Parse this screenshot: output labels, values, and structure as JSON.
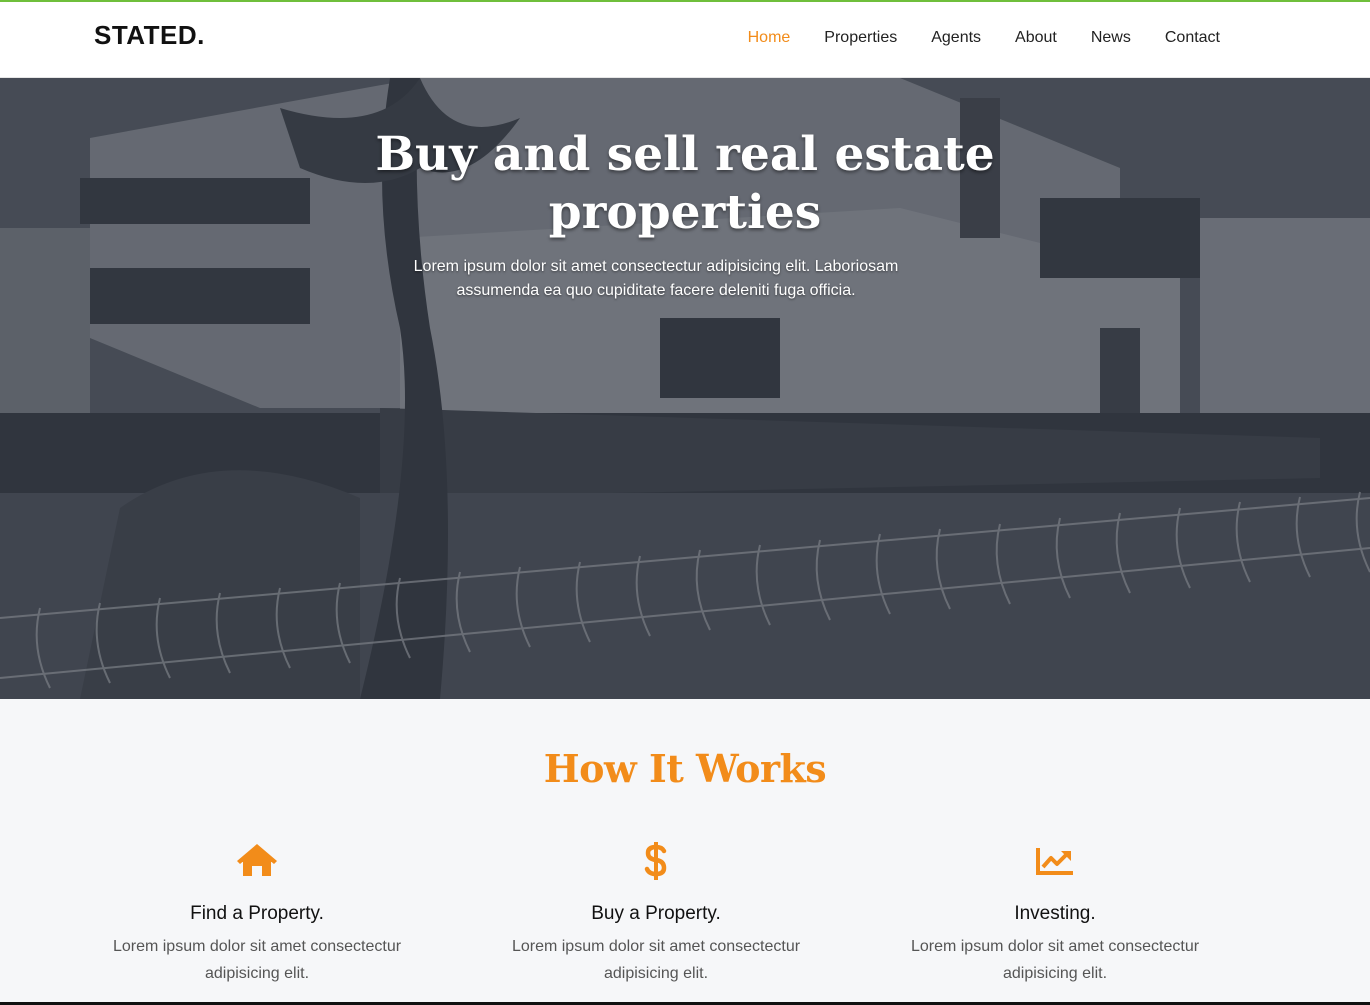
{
  "brand": {
    "logo": "STATED.",
    "accent_color": "#f28c1a",
    "top_accent_color": "#6fbf3b"
  },
  "nav": {
    "items": [
      {
        "label": "Home",
        "active": true
      },
      {
        "label": "Properties",
        "active": false
      },
      {
        "label": "Agents",
        "active": false
      },
      {
        "label": "About",
        "active": false
      },
      {
        "label": "News",
        "active": false
      },
      {
        "label": "Contact",
        "active": false
      }
    ]
  },
  "hero": {
    "title_line1": "Buy and sell real estate",
    "title_line2": "properties",
    "subtitle": "Lorem ipsum dolor sit amet consectectur adipisicing elit. Laboriosam assumenda ea quo cupiditate facere deleniti fuga officia."
  },
  "how_it_works": {
    "title": "How It Works",
    "features": [
      {
        "icon": "home-icon",
        "title": "Find a Property.",
        "text": "Lorem ipsum dolor sit amet consectectur adipisicing elit."
      },
      {
        "icon": "dollar-icon",
        "title": "Buy a Property.",
        "text": "Lorem ipsum dolor sit amet consectectur adipisicing elit."
      },
      {
        "icon": "chart-line-icon",
        "title": "Investing.",
        "text": "Lorem ipsum dolor sit amet consectectur adipisicing elit."
      }
    ]
  }
}
